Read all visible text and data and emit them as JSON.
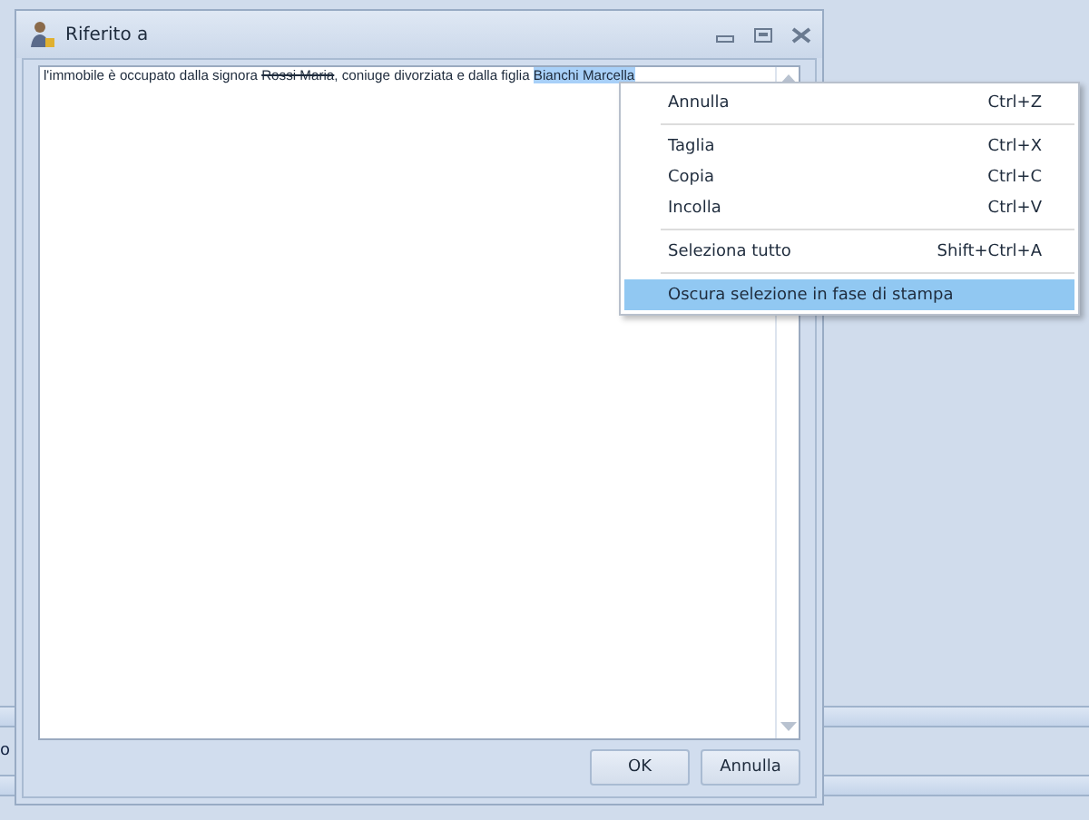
{
  "background": {
    "cut_text": "o"
  },
  "dialog": {
    "title": "Riferito a",
    "text_segments": [
      {
        "kind": "normal",
        "text": "l'immobile è occupato dalla signora "
      },
      {
        "kind": "struck",
        "text": "Rossi Maria"
      },
      {
        "kind": "normal",
        "text": ", coniuge divorziata e dalla figlia "
      },
      {
        "kind": "selected",
        "text": "Bianchi Marcella"
      }
    ],
    "buttons": [
      {
        "label": "OK"
      },
      {
        "label": "Annulla"
      }
    ]
  },
  "context_menu": [
    {
      "kind": "item",
      "label": "Annulla",
      "shortcut": "Ctrl+Z",
      "selected": false
    },
    {
      "kind": "separator"
    },
    {
      "kind": "item",
      "label": "Taglia",
      "shortcut": "Ctrl+X",
      "selected": false
    },
    {
      "kind": "item",
      "label": "Copia",
      "shortcut": "Ctrl+C",
      "selected": false
    },
    {
      "kind": "item",
      "label": "Incolla",
      "shortcut": "Ctrl+V",
      "selected": false
    },
    {
      "kind": "separator"
    },
    {
      "kind": "item",
      "label": "Seleziona tutto",
      "shortcut": "Shift+Ctrl+A",
      "selected": false
    },
    {
      "kind": "separator"
    },
    {
      "kind": "item",
      "label": "Oscura selezione in fase di stampa",
      "selected": true
    }
  ]
}
